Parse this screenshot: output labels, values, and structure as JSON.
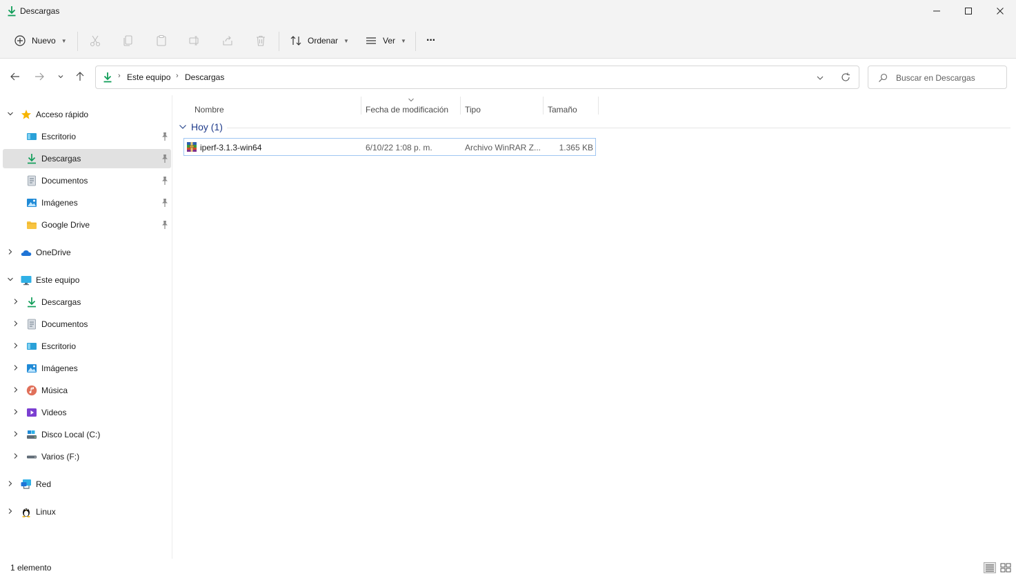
{
  "window": {
    "title": "Descargas",
    "accent": "#0f9d58"
  },
  "toolbar": {
    "new_label": "Nuevo",
    "sort_label": "Ordenar",
    "view_label": "Ver",
    "more_label": "···"
  },
  "address": {
    "crumbs": [
      "Este equipo",
      "Descargas"
    ],
    "search_placeholder": "Buscar en Descargas"
  },
  "sidebar": {
    "quick_access": {
      "label": "Acceso rápido",
      "items": [
        {
          "label": "Escritorio",
          "icon": "desktop-icon"
        },
        {
          "label": "Descargas",
          "icon": "download-icon"
        },
        {
          "label": "Documentos",
          "icon": "documents-icon"
        },
        {
          "label": "Imágenes",
          "icon": "pictures-icon"
        },
        {
          "label": "Google Drive",
          "icon": "folder-icon"
        }
      ]
    },
    "onedrive_label": "OneDrive",
    "this_pc": {
      "label": "Este equipo",
      "items": [
        {
          "label": "Descargas",
          "icon": "download-icon"
        },
        {
          "label": "Documentos",
          "icon": "documents-icon"
        },
        {
          "label": "Escritorio",
          "icon": "desktop-icon"
        },
        {
          "label": "Imágenes",
          "icon": "pictures-icon"
        },
        {
          "label": "Música",
          "icon": "music-icon"
        },
        {
          "label": "Videos",
          "icon": "videos-icon"
        },
        {
          "label": "Disco Local (C:)",
          "icon": "drive-icon"
        },
        {
          "label": "Varios (F:)",
          "icon": "removable-drive-icon"
        }
      ]
    },
    "network_label": "Red",
    "linux_label": "Linux"
  },
  "columns": {
    "name": "Nombre",
    "modified": "Fecha de modificación",
    "type": "Tipo",
    "size": "Tamaño"
  },
  "groups": [
    {
      "label": "Hoy (1)",
      "files": [
        {
          "name": "iperf-3.1.3-win64",
          "modified": "6/10/22 1:08 p. m.",
          "type": "Archivo WinRAR Z...",
          "size": "1.365 KB",
          "icon": "winrar-archive-icon"
        }
      ]
    }
  ],
  "status": {
    "count_text": "1 elemento"
  }
}
